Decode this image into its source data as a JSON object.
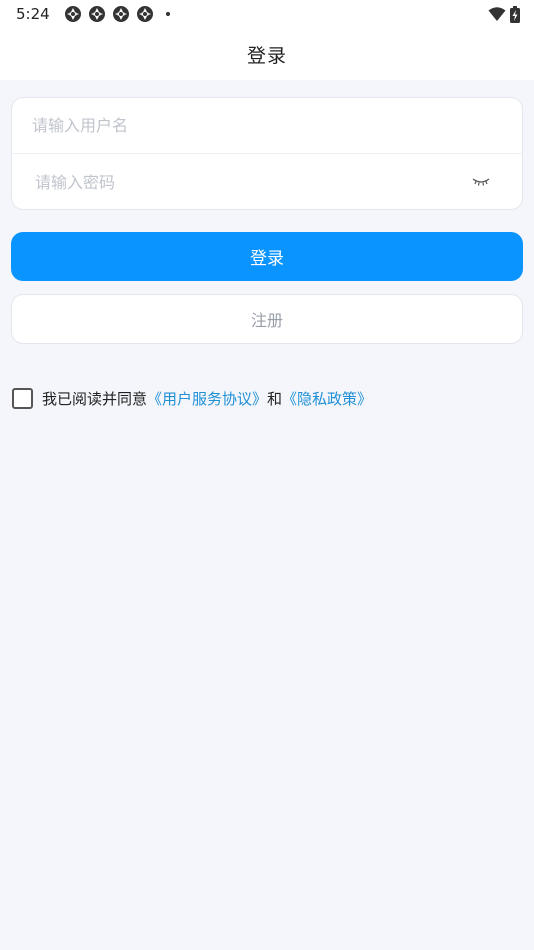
{
  "status_bar": {
    "time": "5:24",
    "notification_icons": [
      "app-notification-icon",
      "app-notification-icon",
      "app-notification-icon",
      "app-notification-icon"
    ],
    "right_icons": [
      "wifi-icon",
      "battery-charging-icon"
    ]
  },
  "header": {
    "title": "登录"
  },
  "form": {
    "username_placeholder": "请输入用户名",
    "username_value": "",
    "password_placeholder": "请输入密码",
    "password_value": "",
    "password_toggle_icon": "eye-closed-icon"
  },
  "buttons": {
    "login_label": "登录",
    "register_label": "注册"
  },
  "agreement": {
    "checked": false,
    "prefix": "我已阅读并同意",
    "terms_link": "《用户服务协议》",
    "conjunction": "和",
    "privacy_link": "《隐私政策》"
  },
  "colors": {
    "primary": "#0a94ff",
    "link": "#1f8fd6",
    "background": "#f4f6fb"
  }
}
